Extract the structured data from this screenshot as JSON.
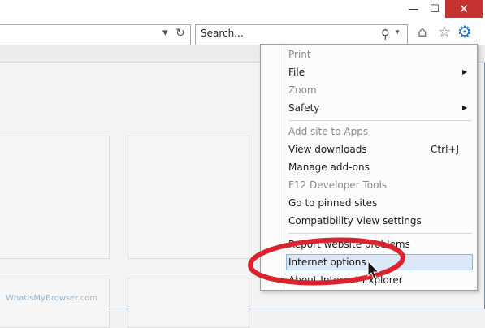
{
  "window": {
    "minimize_glyph": "—",
    "maximize_glyph": "☐",
    "close_glyph": "✕"
  },
  "address": {
    "dropdown_glyph": "▾",
    "refresh_glyph": "↻"
  },
  "search": {
    "placeholder": "Search...",
    "search_glyph": "⚲",
    "dropdown_glyph": "▾"
  },
  "toolbar": {
    "home_glyph": "⌂",
    "favorites_glyph": "☆",
    "tools_glyph": "⚙"
  },
  "menu": {
    "items": [
      {
        "label": "Print",
        "disabled": true
      },
      {
        "label": "File",
        "submenu": true
      },
      {
        "label": "Zoom",
        "disabled": true
      },
      {
        "label": "Safety",
        "submenu": true
      },
      {
        "label": "Add site to Apps",
        "disabled": true
      },
      {
        "label": "View downloads",
        "shortcut": "Ctrl+J"
      },
      {
        "label": "Manage add-ons"
      },
      {
        "label": "F12 Developer Tools",
        "disabled": true
      },
      {
        "label": "Go to pinned sites"
      },
      {
        "label": "Compatibility View settings"
      },
      {
        "label": "Report website problems"
      },
      {
        "label": "Internet options",
        "highlighted": true
      },
      {
        "label": "About Internet Explorer"
      }
    ],
    "submenu_arrow": "▶"
  },
  "watermark": "WhatIsMyBrowser.com",
  "colors": {
    "annotation_red": "#d9232e",
    "tools_blue": "#1d6fc1",
    "close_red": "#c7312f",
    "highlight": "#dbe8f6"
  }
}
